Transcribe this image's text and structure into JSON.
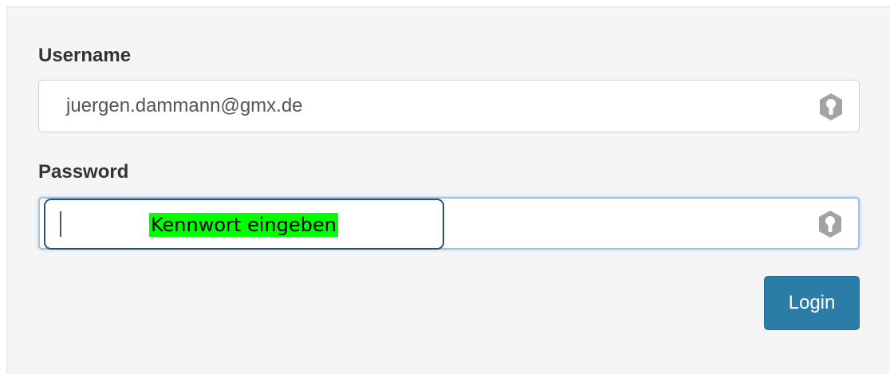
{
  "form": {
    "username_label": "Username",
    "username_value": "juergen.dammann@gmx.de",
    "password_label": "Password",
    "password_value": "",
    "login_label": "Login",
    "key_icon": "key-icon"
  },
  "annotation": {
    "hint_text": "Kennwort eingeben",
    "highlight_color": "#00ff00",
    "box_color": "#2f4f7f"
  },
  "colors": {
    "login_button": "#2b7da8",
    "focus_border": "#9ec3e6",
    "panel_background": "#f5f5f5"
  }
}
